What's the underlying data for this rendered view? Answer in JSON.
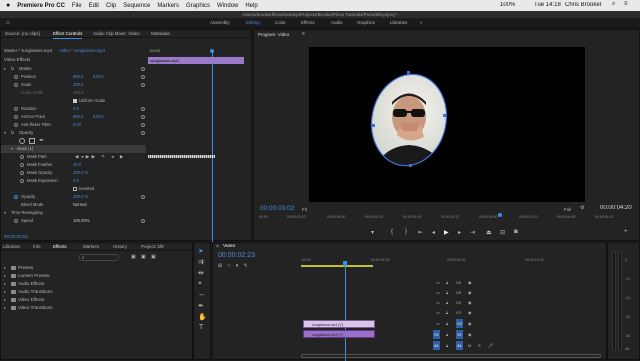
{
  "menubar": {
    "apple": "",
    "items": [
      "Premiere Pro CC",
      "File",
      "Edit",
      "Clip",
      "Sequence",
      "Markers",
      "Graphics",
      "Window",
      "Help"
    ],
    "clock": "Tue 14:18",
    "user": "Chris Brooker",
    "battery": "100%"
  },
  "path": "/Users/brookerfilms/Desktop/Projects/BrookerFilms Tutorials/Prem/bf8.prproj *",
  "workspaces": [
    "Assembly",
    "Editing",
    "Color",
    "Effects",
    "Audio",
    "Graphics",
    "Libraries"
  ],
  "effect_controls": {
    "tabs": [
      "Source: (no clips)",
      "Effect Controls",
      "Audio Clip Mixer: Video",
      "Metadata"
    ],
    "master": "Master * sunglasses.mp4",
    "sequence": "Video * sunglasses.mp4",
    "clip_label": "sunglasses.mp4",
    "ruler_start": ":00:00",
    "section": "Video Effects",
    "rows": [
      {
        "name": "Motion",
        "value": "",
        "value2": ""
      },
      {
        "name": "Position",
        "value": "960.0",
        "value2": "540.0"
      },
      {
        "name": "Scale",
        "value": "100.0",
        "value2": ""
      },
      {
        "name": "Scale Width",
        "value": "100.0",
        "value2": ""
      },
      {
        "name": "Uniform Scale",
        "value": "",
        "value2": ""
      },
      {
        "name": "Rotation",
        "value": "0.0",
        "value2": ""
      },
      {
        "name": "Anchor Point",
        "value": "960.0",
        "value2": "540.0"
      },
      {
        "name": "Anti-flicker Filter",
        "value": "0.00",
        "value2": ""
      },
      {
        "name": "Opacity",
        "value": "",
        "value2": ""
      },
      {
        "name": "Mask (1)",
        "value": "",
        "value2": ""
      },
      {
        "name": "Mask Path",
        "value": "",
        "value2": ""
      },
      {
        "name": "Mask Feather",
        "value": "10.0",
        "value2": ""
      },
      {
        "name": "Mask Opacity",
        "value": "100.0 %",
        "value2": ""
      },
      {
        "name": "Mask Expansion",
        "value": "0.0",
        "value2": ""
      },
      {
        "name": "Inverted",
        "value": "",
        "value2": ""
      },
      {
        "name": "Opacity",
        "value": "100.0 %",
        "value2": ""
      },
      {
        "name": "Blend Mode",
        "value": "Normal",
        "value2": ""
      },
      {
        "name": "Time Remapping",
        "value": "",
        "value2": ""
      },
      {
        "name": "Speed",
        "value": "100.00%",
        "value2": ""
      }
    ],
    "timecode": "00:00:03:04"
  },
  "program": {
    "title": "Program: Video",
    "timecode": "00:00:03:02",
    "fit": "Fit",
    "quality": "Full",
    "duration": "00:00:04:20",
    "ruler": [
      "00:00",
      "00:00:01:00",
      "00:00:02:00",
      "00:00:03:00",
      "00:00:04:00"
    ],
    "ruler_sub": [
      "00:00:00:12",
      "00:00:01:12",
      "00:00:02:12",
      "00:00:03:12",
      "00:00:04:12"
    ]
  },
  "project": {
    "tabs": [
      "Libraries",
      "Info",
      "Effects",
      "Markers",
      "History",
      "Project: bf8"
    ],
    "items": [
      "Presets",
      "Lumetri Presets",
      "Audio Effects",
      "Audio Transitions",
      "Video Effects",
      "Video Transitions"
    ]
  },
  "timeline": {
    "tab": "Video",
    "timecode": "00:00:02:23",
    "ruler": [
      ":00:00",
      "00:00:04:23",
      "00:00:09:23",
      "00:00:14:23"
    ],
    "tracks": [
      "V6",
      "V5",
      "V4",
      "V3",
      "V2",
      "V1",
      "A1"
    ],
    "src_v": "V1",
    "src_a": "A1",
    "clip_top": "sunglasses.mp4 [V]",
    "clip_bottom": "sunglasses.mp4 [V]"
  },
  "meter_scale": [
    "0",
    "-12",
    "-24",
    "-36",
    "-48",
    "dB"
  ]
}
